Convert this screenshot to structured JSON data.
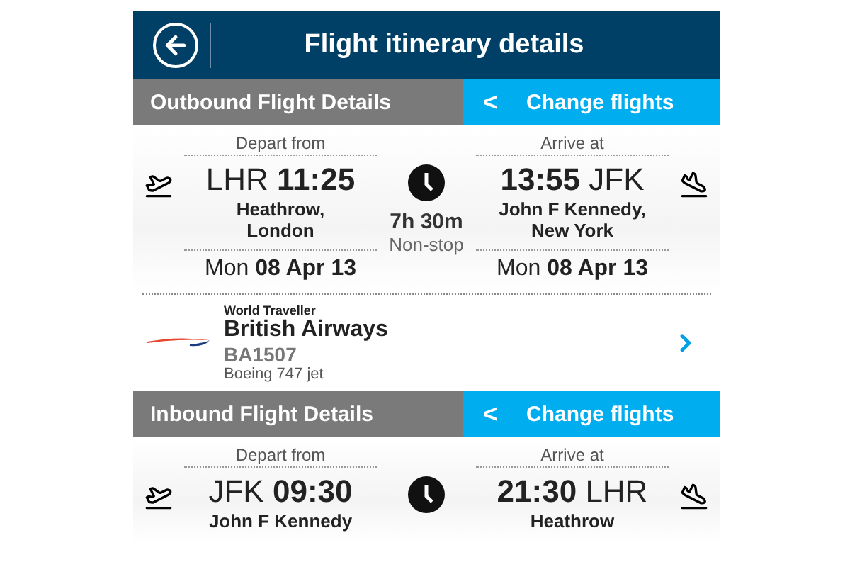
{
  "header": {
    "title": "Flight itinerary details"
  },
  "sections": [
    {
      "title": "Outbound Flight Details",
      "change_label": "Change flights",
      "change_icon": "<",
      "depart": {
        "label": "Depart from",
        "code": "LHR",
        "time": "11:25",
        "city": [
          "Heathrow,",
          "London"
        ],
        "date": "Mon **08 Apr 13**"
      },
      "duration": "7h 30m",
      "stops": "Non-stop",
      "arrive": {
        "label": "Arrive at",
        "code": "JFK",
        "time": "13:55",
        "city": [
          "John F Kennedy,",
          "New York"
        ],
        "date": "Mon **08 Apr 13**"
      },
      "airline": {
        "cabin": "World Traveller",
        "name": "British Airways",
        "flight": "BA1507",
        "aircraft": "Boeing 747 jet"
      }
    },
    {
      "title": "Inbound Flight Details",
      "change_label": "Change flights",
      "change_icon": "<",
      "depart": {
        "label": "Depart from",
        "code": "JFK",
        "time": "09:30",
        "city": [
          "John F Kennedy"
        ]
      },
      "arrive": {
        "label": "Arrive at",
        "code": "LHR",
        "time": "21:30",
        "city": [
          "Heathrow"
        ]
      }
    }
  ]
}
